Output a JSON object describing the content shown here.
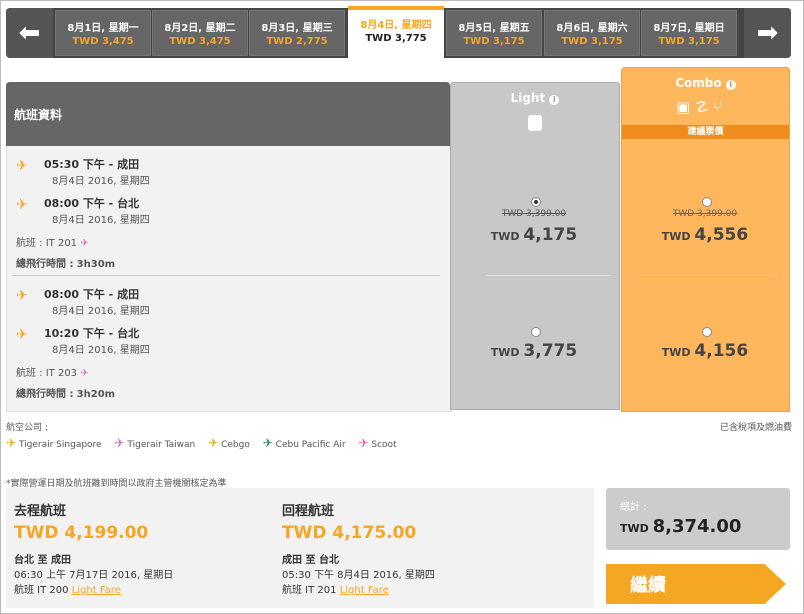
{
  "dates": [
    {
      "date": "8月1日, 星期一",
      "price": "TWD 3,475"
    },
    {
      "date": "8月2日, 星期二",
      "price": "TWD 3,475"
    },
    {
      "date": "8月3日, 星期三",
      "price": "TWD 2,775"
    },
    {
      "date": "8月4日, 星期四",
      "price": "TWD 3,775",
      "active": true
    },
    {
      "date": "8月5日, 星期五",
      "price": "TWD 3,175"
    },
    {
      "date": "8月6日, 星期六",
      "price": "TWD 3,175"
    },
    {
      "date": "8月7日, 星期日",
      "price": "TWD 3,175"
    }
  ],
  "table": {
    "header": "航班資料",
    "light_label": "Light",
    "combo_label": "Combo",
    "combo_badge": "建議票價"
  },
  "flights": [
    {
      "dep_time": "05:30 下午 - 成田",
      "dep_date": "8月4日 2016, 星期四",
      "arr_time": "08:00 下午 - 台北",
      "arr_date": "8月4日 2016, 星期四",
      "flight": "航班 : IT 201",
      "duration_label": "總飛行時間 :",
      "duration": "3h30m",
      "light_old": "TWD 3,399.00",
      "light_price": "TWD",
      "light_amount": "4,175",
      "combo_old": "TWD 3,399.00",
      "combo_price": "TWD",
      "combo_amount": "4,556"
    },
    {
      "dep_time": "08:00 下午 - 成田",
      "dep_date": "8月4日 2016, 星期四",
      "arr_time": "10:20 下午 - 台北",
      "arr_date": "8月4日 2016, 星期四",
      "flight": "航班 : IT 203",
      "duration_label": "總飛行時間 :",
      "duration": "3h20m",
      "light_price": "TWD",
      "light_amount": "3,775",
      "combo_price": "TWD",
      "combo_amount": "4,156"
    }
  ],
  "airlines_label": "航空公司 :",
  "airlines": [
    "Tigerair Singapore",
    "Tigerair Taiwan",
    "Cebgo",
    "Cebu Pacific Air",
    "Scoot"
  ],
  "tax_note": "已含稅項及燃油費",
  "disclaimer": "*實際營運日期及航班離到時間以政府主管機關核定為準",
  "outbound": {
    "title": "去程航班",
    "amount": "TWD 4,199.00",
    "route": "台北 至 成田",
    "time": "06:30 上午 7月17日 2016, 星期日",
    "flight": "航班 IT 200",
    "fare": "Light Fare"
  },
  "inbound": {
    "title": "回程航班",
    "amount": "TWD 4,175.00",
    "route": "成田 至 台北",
    "time": "05:30 下午 8月4日 2016, 星期四",
    "flight": "航班 IT 201",
    "fare": "Light Fare"
  },
  "total": {
    "label": "總計 :",
    "currency": "TWD",
    "amount": "8,374.00"
  },
  "continue_label": "繼續",
  "colors": {
    "accent": "#f5a623",
    "combo": "#ffb75e",
    "dark": "#444444"
  }
}
